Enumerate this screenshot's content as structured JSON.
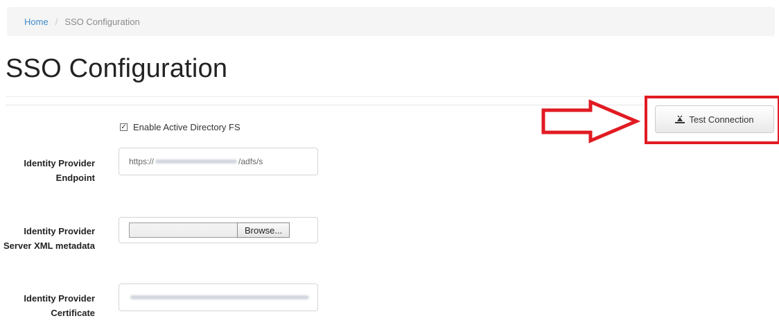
{
  "breadcrumb": {
    "home": "Home",
    "separator": "/",
    "current": "SSO Configuration"
  },
  "page": {
    "title": "SSO Configuration"
  },
  "form": {
    "enable_adfs_label": "Enable Active Directory FS",
    "enable_adfs_checked": true,
    "endpoint_label": "Identity Provider Endpoint",
    "endpoint_value_prefix": "https://",
    "endpoint_value_suffix": "/adfs/s",
    "metadata_label": "Identity Provider Server XML metadata",
    "browse_label": "Browse...",
    "certificate_label": "Identity Provider Certificate"
  },
  "toolbar": {
    "test_connection_label": "Test Connection"
  },
  "annotation": {
    "color": "#e11b22"
  },
  "colors": {
    "link": "#428bca",
    "breadcrumb_bg": "#f5f5f5"
  }
}
